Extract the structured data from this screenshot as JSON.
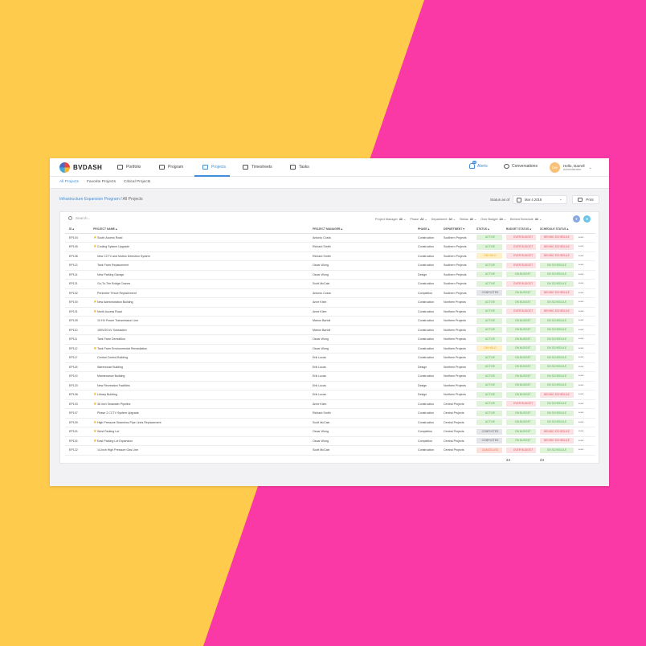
{
  "colors": {
    "background_yellow": "#fecb4c",
    "background_pink": "#fa39a6",
    "accent": "#3f8fd8",
    "status_styles": {
      "ACTIVE": {
        "bg": "#dff3d9",
        "fg": "#4caf50"
      },
      "ON HOLD": {
        "bg": "#ffefc7",
        "fg": "#e0a418"
      },
      "COMPLETED": {
        "bg": "#e4e5e8",
        "fg": "#666666"
      },
      "CANCELLED": {
        "bg": "#fde0d9",
        "fg": "#e46b4d"
      },
      "OVER BUDGET": {
        "bg": "#fbe1e3",
        "fg": "#e05563"
      },
      "ON BUDGET": {
        "bg": "#dff3d9",
        "fg": "#4caf50"
      },
      "BEHIND SCHEDULE": {
        "bg": "#fbe1e3",
        "fg": "#e05563"
      },
      "ON SCHEDULE": {
        "bg": "#dff3d9",
        "fg": "#4caf50"
      }
    }
  },
  "brand": {
    "name": "BVDASH"
  },
  "nav": {
    "items": [
      {
        "label": "Portfolio",
        "icon": "briefcase-icon"
      },
      {
        "label": "Program",
        "icon": "sitemap-icon"
      },
      {
        "label": "Projects",
        "icon": "projects-icon"
      },
      {
        "label": "Timesheets",
        "icon": "timesheet-icon"
      },
      {
        "label": "Tasks",
        "icon": "tasks-icon"
      }
    ],
    "alerts_label": "Alerts",
    "alerts_count": "10",
    "conversations_label": "Conversations",
    "user": {
      "greeting": "Hello, Darrell",
      "role": "Administrator",
      "initials": "DW"
    }
  },
  "subtabs": [
    "All Projects",
    "Favorite Projects",
    "Critical Projects"
  ],
  "breadcrumb": {
    "parent": "Infrastructure Expansion Program",
    "separator": " / ",
    "current": "All Projects"
  },
  "status_as_of": {
    "label": "Status as of",
    "date": "Mar 4 2018"
  },
  "print_label": "Print",
  "search": {
    "placeholder": "Search..."
  },
  "filters": [
    {
      "label": "Project Manager",
      "value": "All"
    },
    {
      "label": "Phase",
      "value": "All"
    },
    {
      "label": "Department",
      "value": "All"
    },
    {
      "label": "Status",
      "value": "All"
    },
    {
      "label": "Over Budget",
      "value": "All"
    },
    {
      "label": "Behind Schedule",
      "value": "All"
    }
  ],
  "table": {
    "columns": [
      "ID",
      "PROJECT NAME",
      "PROJECT MANAGER",
      "PHASE",
      "DEPARTMENT",
      "STATUS",
      "BUDGET STATUS",
      "SCHEDULE STATUS",
      ""
    ],
    "rows": [
      {
        "id": "EP104",
        "star": true,
        "name": "South Access Road",
        "manager": "Antonio Costa",
        "phase": "Construction",
        "dept": "Southern Projects",
        "status": "ACTIVE",
        "budget": "OVER BUDGET",
        "schedule": "BEHIND SCHEDULE"
      },
      {
        "id": "EP105",
        "star": true,
        "name": "Cooling System Upgrade",
        "manager": "Richard Smith",
        "phase": "Construction",
        "dept": "Southern Projects",
        "status": "ACTIVE",
        "budget": "OVER BUDGET",
        "schedule": "BEHIND SCHEDULE"
      },
      {
        "id": "EP106",
        "star": false,
        "name": "New CCTV and Motion Detection System",
        "manager": "Richard Smith",
        "phase": "Construction",
        "dept": "Southern Projects",
        "status": "ON HOLD",
        "budget": "OVER BUDGET",
        "schedule": "BEHIND SCHEDULE"
      },
      {
        "id": "EP113",
        "star": false,
        "name": "Tank Farm Replacement",
        "manager": "Oscar Wong",
        "phase": "Construction",
        "dept": "Southern Projects",
        "status": "ACTIVE",
        "budget": "OVER BUDGET",
        "schedule": "ON SCHEDULE"
      },
      {
        "id": "EP114",
        "star": false,
        "name": "New Parking Garage",
        "manager": "Oscar Wong",
        "phase": "Design",
        "dept": "Southern Projects",
        "status": "ACTIVE",
        "budget": "ON BUDGET",
        "schedule": "ON SCHEDULE"
      },
      {
        "id": "EP121",
        "star": false,
        "name": "Go-To-The Bridge Cranes",
        "manager": "Scott McCain",
        "phase": "Construction",
        "dept": "Southern Projects",
        "status": "ACTIVE",
        "budget": "OVER BUDGET",
        "schedule": "ON SCHEDULE"
      },
      {
        "id": "EP102",
        "star": false,
        "name": "Perimeter Fence Replacement",
        "manager": "Antonio Costa",
        "phase": "Completion",
        "dept": "Southern Projects",
        "status": "COMPLETED",
        "budget": "ON BUDGET",
        "schedule": "BEHIND SCHEDULE"
      },
      {
        "id": "EP100",
        "star": true,
        "name": "New Administration Building",
        "manager": "Anne Klein",
        "phase": "Construction",
        "dept": "Northern Projects",
        "status": "ACTIVE",
        "budget": "ON BUDGET",
        "schedule": "ON SCHEDULE"
      },
      {
        "id": "EP101",
        "star": true,
        "name": "North Access Road",
        "manager": "Anne Klein",
        "phase": "Construction",
        "dept": "Northern Projects",
        "status": "ACTIVE",
        "budget": "OVER BUDGET",
        "schedule": "BEHIND SCHEDULE"
      },
      {
        "id": "EP109",
        "star": false,
        "name": "10 HV Power Transmission Line",
        "manager": "Marion Bartoli",
        "phase": "Construction",
        "dept": "Northern Projects",
        "status": "ACTIVE",
        "budget": "ON BUDGET",
        "schedule": "ON SCHEDULE"
      },
      {
        "id": "EP110",
        "star": false,
        "name": "150V/20 kV Substation",
        "manager": "Marion Bartoli",
        "phase": "Construction",
        "dept": "Northern Projects",
        "status": "ACTIVE",
        "budget": "ON BUDGET",
        "schedule": "ON SCHEDULE"
      },
      {
        "id": "EP111",
        "star": false,
        "name": "Tank Farm Demolition",
        "manager": "Oscar Wong",
        "phase": "Construction",
        "dept": "Northern Projects",
        "status": "ACTIVE",
        "budget": "ON BUDGET",
        "schedule": "ON SCHEDULE"
      },
      {
        "id": "EP112",
        "star": true,
        "name": "Tank Farm Environmental Remediation",
        "manager": "Oscar Wong",
        "phase": "Construction",
        "dept": "Northern Projects",
        "status": "ON HOLD",
        "budget": "ON BUDGET",
        "schedule": "ON SCHEDULE"
      },
      {
        "id": "EP117",
        "star": false,
        "name": "Central Control Building",
        "manager": "Erik Lucas",
        "phase": "Construction",
        "dept": "Northern Projects",
        "status": "ACTIVE",
        "budget": "ON BUDGET",
        "schedule": "ON SCHEDULE"
      },
      {
        "id": "EP118",
        "star": false,
        "name": "Warehouse Building",
        "manager": "Erik Lucas",
        "phase": "Design",
        "dept": "Northern Projects",
        "status": "ACTIVE",
        "budget": "ON BUDGET",
        "schedule": "ON SCHEDULE"
      },
      {
        "id": "EP119",
        "star": false,
        "name": "Maintenance Building",
        "manager": "Erik Lucas",
        "phase": "Construction",
        "dept": "Northern Projects",
        "status": "ACTIVE",
        "budget": "ON BUDGET",
        "schedule": "ON SCHEDULE"
      },
      {
        "id": "EP120",
        "star": false,
        "name": "New Recreation Facilities",
        "manager": "Erik Lucas",
        "phase": "Design",
        "dept": "Northern Projects",
        "status": "ACTIVE",
        "budget": "ON BUDGET",
        "schedule": "ON SCHEDULE"
      },
      {
        "id": "EP108",
        "star": true,
        "name": "Library Building",
        "manager": "Erik Lucas",
        "phase": "Design",
        "dept": "Northern Projects",
        "status": "ACTIVE",
        "budget": "ON BUDGET",
        "schedule": "BEHIND SCHEDULE"
      },
      {
        "id": "EP103",
        "star": true,
        "name": "36 inch Seawater Pipeline",
        "manager": "Anne Klein",
        "phase": "Construction",
        "dept": "Central Projects",
        "status": "ACTIVE",
        "budget": "OVER BUDGET",
        "schedule": "ON SCHEDULE"
      },
      {
        "id": "EP107",
        "star": false,
        "name": "Phase 2 CCTV System Upgrade",
        "manager": "Richard Smith",
        "phase": "Construction",
        "dept": "Central Projects",
        "status": "ACTIVE",
        "budget": "ON BUDGET",
        "schedule": "ON SCHEDULE"
      },
      {
        "id": "EP109",
        "star": true,
        "name": "High Pressure Seamless Pipe Lines Replacement",
        "manager": "Scott McCain",
        "phase": "Construction",
        "dept": "Central Projects",
        "status": "ACTIVE",
        "budget": "ON BUDGET",
        "schedule": "ON SCHEDULE"
      },
      {
        "id": "EP115",
        "star": true,
        "name": "West Parking Lot",
        "manager": "Oscar Wong",
        "phase": "Completion",
        "dept": "Central Projects",
        "status": "COMPLETED",
        "budget": "ON BUDGET",
        "schedule": "BEHIND SCHEDULE"
      },
      {
        "id": "EP116",
        "star": true,
        "name": "East Parking Lot Expansion",
        "manager": "Oscar Wong",
        "phase": "Completion",
        "dept": "Central Projects",
        "status": "COMPLETED",
        "budget": "ON BUDGET",
        "schedule": "BEHIND SCHEDULE"
      },
      {
        "id": "EP122",
        "star": false,
        "name": "14-inch High Pressure Gas Line",
        "manager": "Scott McCain",
        "phase": "Construction",
        "dept": "Central Projects",
        "status": "CANCELLED",
        "budget": "OVER BUDGET",
        "schedule": "ON SCHEDULE"
      }
    ],
    "totals": {
      "budget": "24",
      "schedule": "24"
    }
  }
}
